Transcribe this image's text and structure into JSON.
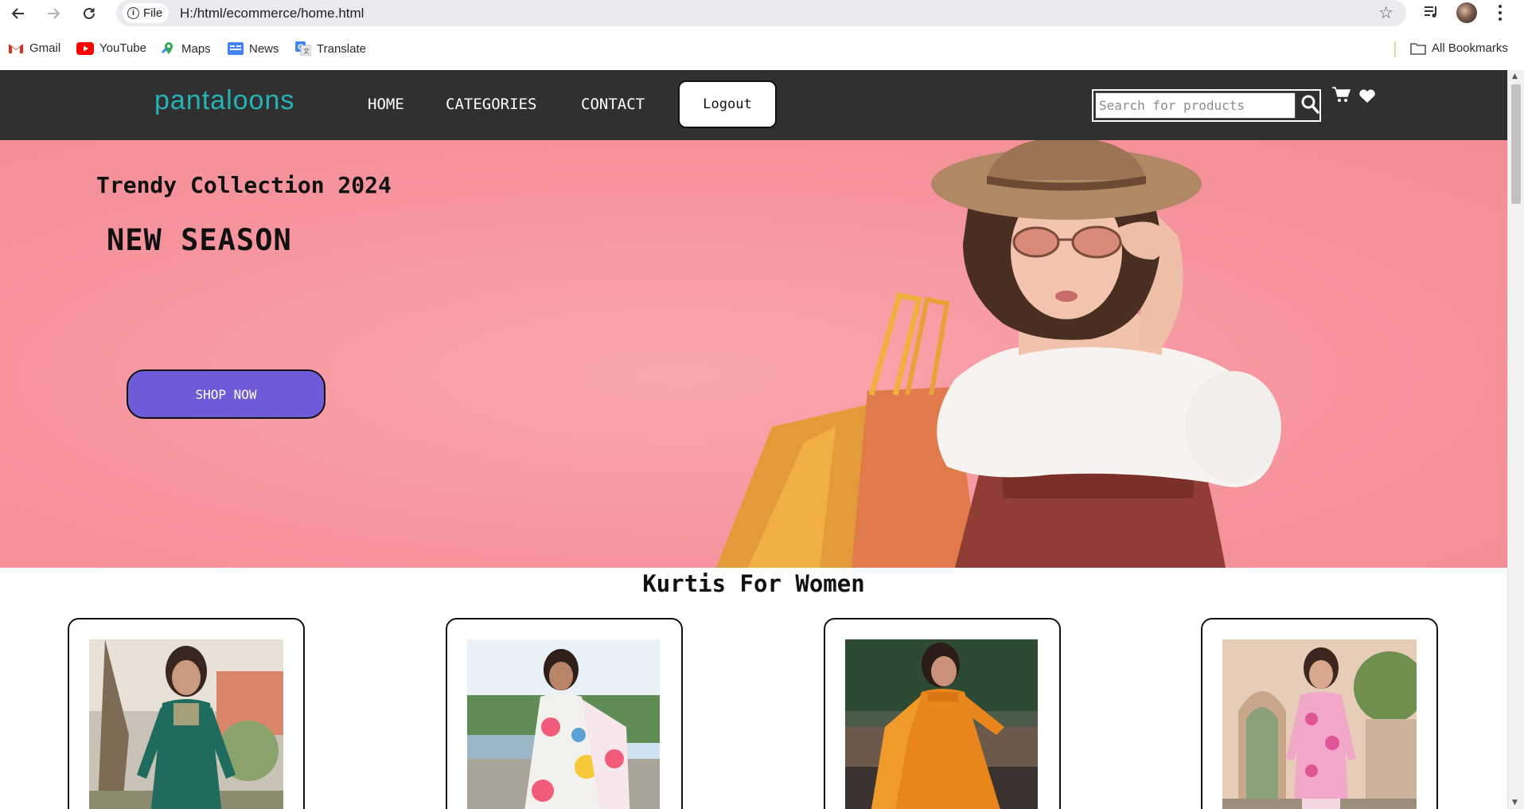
{
  "browser": {
    "site_chip_label": "File",
    "url": "H:/html/ecommerce/home.html",
    "bookmarks": [
      {
        "label": "Gmail",
        "icon": "gmail-icon",
        "color": "#d93025"
      },
      {
        "label": "YouTube",
        "icon": "youtube-icon",
        "color": "#ff0000"
      },
      {
        "label": "Maps",
        "icon": "maps-icon",
        "color": "#34a853"
      },
      {
        "label": "News",
        "icon": "news-icon",
        "color": "#4285f4"
      },
      {
        "label": "Translate",
        "icon": "translate-icon",
        "color": "#4285f4"
      }
    ],
    "all_bookmarks_label": "All Bookmarks"
  },
  "site": {
    "brand": "pantaloons",
    "brand_color": "#27b3b6",
    "nav": {
      "home": "HOME",
      "categories": "CATEGORIES",
      "contact": "CONTACT"
    },
    "logout_label": "Logout",
    "search_placeholder": "Search for products",
    "header_color": "#303030"
  },
  "hero": {
    "subtitle": "Trendy Collection 2024",
    "title": "NEW SEASON",
    "cta_label": "SHOP NOW",
    "cta_color": "#6f5ad8",
    "background_color": "#f6959f"
  },
  "products": {
    "section_title": "Kurtis For Women",
    "items": [
      {
        "image": "green kurti",
        "dress_color": "#1f6b5e"
      },
      {
        "image": "white floral kurti",
        "dress_color": "#f3f1ee"
      },
      {
        "image": "orange kurti",
        "dress_color": "#e8861c"
      },
      {
        "image": "pink floral kurti",
        "dress_color": "#f1a7c7"
      }
    ]
  }
}
